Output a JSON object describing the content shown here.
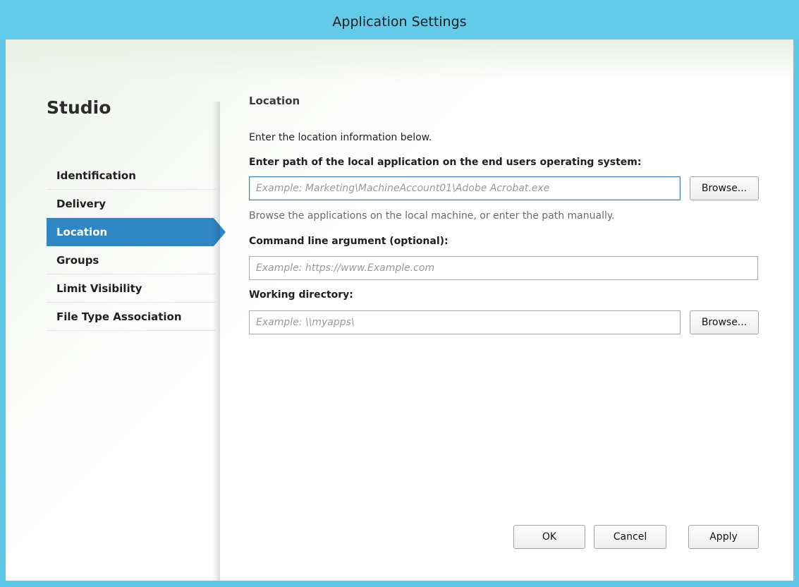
{
  "window": {
    "title": "Application Settings"
  },
  "sidebar": {
    "title": "Studio",
    "items": [
      {
        "label": "Identification",
        "active": false
      },
      {
        "label": "Delivery",
        "active": false
      },
      {
        "label": "Location",
        "active": true
      },
      {
        "label": "Groups",
        "active": false
      },
      {
        "label": "Limit Visibility",
        "active": false
      },
      {
        "label": "File Type Association",
        "active": false
      }
    ]
  },
  "main": {
    "section_title": "Location",
    "intro": "Enter the location information below.",
    "path_label": "Enter path of the local application on the end users operating system:",
    "path_input": {
      "value": "",
      "placeholder": "Example: Marketing\\MachineAccount01\\Adobe Acrobat.exe"
    },
    "path_browse_label": "Browse...",
    "path_hint": "Browse the applications on the local machine, or enter the path manually.",
    "args_label": "Command line argument (optional):",
    "args_input": {
      "value": "",
      "placeholder": "Example: https://www.Example.com"
    },
    "workdir_label": "Working directory:",
    "workdir_input": {
      "value": "",
      "placeholder": "Example: \\\\myapps\\"
    },
    "workdir_browse_label": "Browse..."
  },
  "footer": {
    "ok_label": "OK",
    "cancel_label": "Cancel",
    "apply_label": "Apply"
  },
  "colors": {
    "titlebar": "#62cbea",
    "accent": "#2f86c4",
    "focus_border": "#3c7fb1"
  }
}
